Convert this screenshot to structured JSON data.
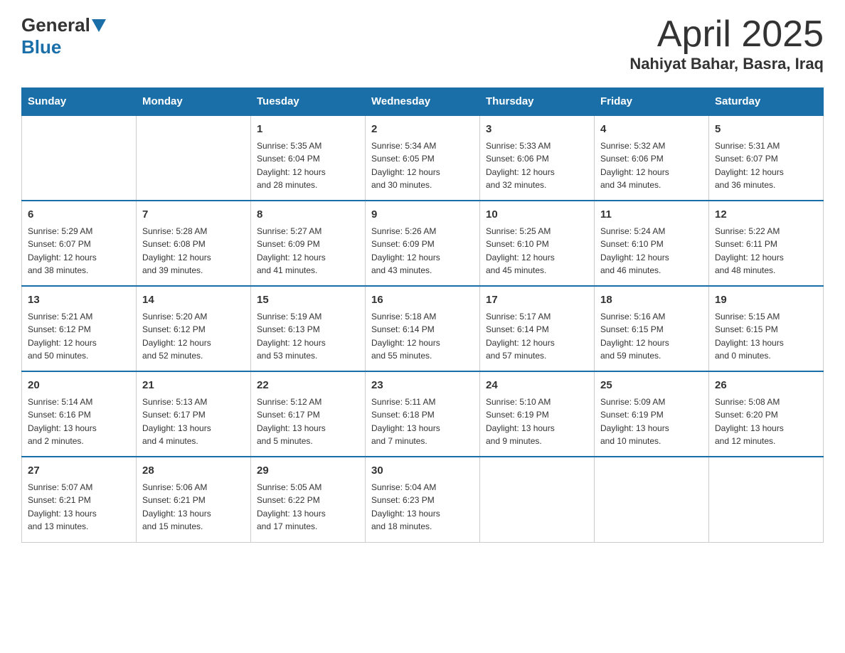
{
  "header": {
    "logo_general": "General",
    "logo_blue": "Blue",
    "month_title": "April 2025",
    "location": "Nahiyat Bahar, Basra, Iraq"
  },
  "days_of_week": [
    "Sunday",
    "Monday",
    "Tuesday",
    "Wednesday",
    "Thursday",
    "Friday",
    "Saturday"
  ],
  "weeks": [
    [
      {
        "day": "",
        "info": ""
      },
      {
        "day": "",
        "info": ""
      },
      {
        "day": "1",
        "info": "Sunrise: 5:35 AM\nSunset: 6:04 PM\nDaylight: 12 hours\nand 28 minutes."
      },
      {
        "day": "2",
        "info": "Sunrise: 5:34 AM\nSunset: 6:05 PM\nDaylight: 12 hours\nand 30 minutes."
      },
      {
        "day": "3",
        "info": "Sunrise: 5:33 AM\nSunset: 6:06 PM\nDaylight: 12 hours\nand 32 minutes."
      },
      {
        "day": "4",
        "info": "Sunrise: 5:32 AM\nSunset: 6:06 PM\nDaylight: 12 hours\nand 34 minutes."
      },
      {
        "day": "5",
        "info": "Sunrise: 5:31 AM\nSunset: 6:07 PM\nDaylight: 12 hours\nand 36 minutes."
      }
    ],
    [
      {
        "day": "6",
        "info": "Sunrise: 5:29 AM\nSunset: 6:07 PM\nDaylight: 12 hours\nand 38 minutes."
      },
      {
        "day": "7",
        "info": "Sunrise: 5:28 AM\nSunset: 6:08 PM\nDaylight: 12 hours\nand 39 minutes."
      },
      {
        "day": "8",
        "info": "Sunrise: 5:27 AM\nSunset: 6:09 PM\nDaylight: 12 hours\nand 41 minutes."
      },
      {
        "day": "9",
        "info": "Sunrise: 5:26 AM\nSunset: 6:09 PM\nDaylight: 12 hours\nand 43 minutes."
      },
      {
        "day": "10",
        "info": "Sunrise: 5:25 AM\nSunset: 6:10 PM\nDaylight: 12 hours\nand 45 minutes."
      },
      {
        "day": "11",
        "info": "Sunrise: 5:24 AM\nSunset: 6:10 PM\nDaylight: 12 hours\nand 46 minutes."
      },
      {
        "day": "12",
        "info": "Sunrise: 5:22 AM\nSunset: 6:11 PM\nDaylight: 12 hours\nand 48 minutes."
      }
    ],
    [
      {
        "day": "13",
        "info": "Sunrise: 5:21 AM\nSunset: 6:12 PM\nDaylight: 12 hours\nand 50 minutes."
      },
      {
        "day": "14",
        "info": "Sunrise: 5:20 AM\nSunset: 6:12 PM\nDaylight: 12 hours\nand 52 minutes."
      },
      {
        "day": "15",
        "info": "Sunrise: 5:19 AM\nSunset: 6:13 PM\nDaylight: 12 hours\nand 53 minutes."
      },
      {
        "day": "16",
        "info": "Sunrise: 5:18 AM\nSunset: 6:14 PM\nDaylight: 12 hours\nand 55 minutes."
      },
      {
        "day": "17",
        "info": "Sunrise: 5:17 AM\nSunset: 6:14 PM\nDaylight: 12 hours\nand 57 minutes."
      },
      {
        "day": "18",
        "info": "Sunrise: 5:16 AM\nSunset: 6:15 PM\nDaylight: 12 hours\nand 59 minutes."
      },
      {
        "day": "19",
        "info": "Sunrise: 5:15 AM\nSunset: 6:15 PM\nDaylight: 13 hours\nand 0 minutes."
      }
    ],
    [
      {
        "day": "20",
        "info": "Sunrise: 5:14 AM\nSunset: 6:16 PM\nDaylight: 13 hours\nand 2 minutes."
      },
      {
        "day": "21",
        "info": "Sunrise: 5:13 AM\nSunset: 6:17 PM\nDaylight: 13 hours\nand 4 minutes."
      },
      {
        "day": "22",
        "info": "Sunrise: 5:12 AM\nSunset: 6:17 PM\nDaylight: 13 hours\nand 5 minutes."
      },
      {
        "day": "23",
        "info": "Sunrise: 5:11 AM\nSunset: 6:18 PM\nDaylight: 13 hours\nand 7 minutes."
      },
      {
        "day": "24",
        "info": "Sunrise: 5:10 AM\nSunset: 6:19 PM\nDaylight: 13 hours\nand 9 minutes."
      },
      {
        "day": "25",
        "info": "Sunrise: 5:09 AM\nSunset: 6:19 PM\nDaylight: 13 hours\nand 10 minutes."
      },
      {
        "day": "26",
        "info": "Sunrise: 5:08 AM\nSunset: 6:20 PM\nDaylight: 13 hours\nand 12 minutes."
      }
    ],
    [
      {
        "day": "27",
        "info": "Sunrise: 5:07 AM\nSunset: 6:21 PM\nDaylight: 13 hours\nand 13 minutes."
      },
      {
        "day": "28",
        "info": "Sunrise: 5:06 AM\nSunset: 6:21 PM\nDaylight: 13 hours\nand 15 minutes."
      },
      {
        "day": "29",
        "info": "Sunrise: 5:05 AM\nSunset: 6:22 PM\nDaylight: 13 hours\nand 17 minutes."
      },
      {
        "day": "30",
        "info": "Sunrise: 5:04 AM\nSunset: 6:23 PM\nDaylight: 13 hours\nand 18 minutes."
      },
      {
        "day": "",
        "info": ""
      },
      {
        "day": "",
        "info": ""
      },
      {
        "day": "",
        "info": ""
      }
    ]
  ]
}
